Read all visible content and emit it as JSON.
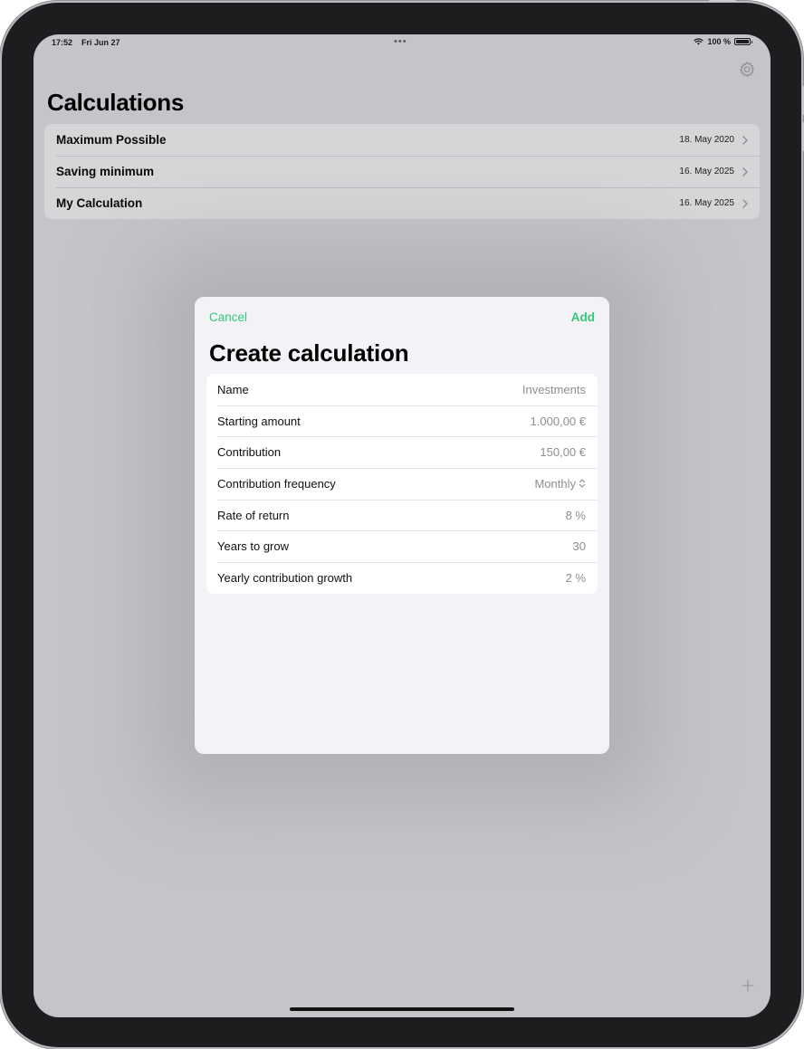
{
  "status_bar": {
    "time": "17:52",
    "date": "Fri Jun 27",
    "dots": "•••",
    "battery": "100 %"
  },
  "page": {
    "title": "Calculations"
  },
  "calculations": [
    {
      "name": "Maximum Possible",
      "date": "18. May 2020"
    },
    {
      "name": "Saving minimum",
      "date": "16. May 2025"
    },
    {
      "name": "My Calculation",
      "date": "16. May 2025"
    }
  ],
  "sheet": {
    "cancel_label": "Cancel",
    "add_label": "Add",
    "title": "Create calculation",
    "fields": [
      {
        "label": "Name",
        "value": "Investments"
      },
      {
        "label": "Starting amount",
        "value": "1.000,00 €"
      },
      {
        "label": "Contribution",
        "value": "150,00 €"
      },
      {
        "label": "Contribution frequency",
        "value": "Monthly"
      },
      {
        "label": "Rate of return",
        "value": "8 %"
      },
      {
        "label": "Years to grow",
        "value": "30"
      },
      {
        "label": "Yearly contribution growth",
        "value": "2 %"
      }
    ]
  },
  "colors": {
    "accent": "#34c77b",
    "dimmed_background": "#c5c5c9",
    "sheet_background": "#f2f2f7"
  },
  "icons": {
    "settings": "gear-icon",
    "row_disclosure": "chevron-right-icon",
    "picker": "chevron-up-down-icon",
    "add": "plus-icon",
    "wifi": "wifi-icon",
    "battery": "battery-icon"
  }
}
